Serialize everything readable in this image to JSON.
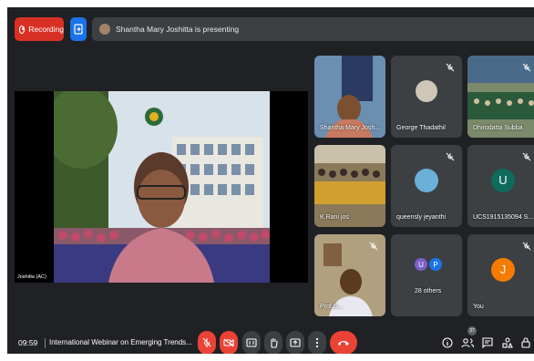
{
  "recording": {
    "label": "Recording"
  },
  "banner": {
    "text": "Shantha Mary Joshitta is presenting"
  },
  "stage": {
    "presenter_label": "Joshitta (AC)"
  },
  "tiles": [
    {
      "label": "Shantha Mary Josh..."
    },
    {
      "label": "George Thadathil"
    },
    {
      "label": "Dhirodatta Subba"
    },
    {
      "label": "K.Rani jos"
    },
    {
      "label": "queensly jeyanthi"
    },
    {
      "label": "UCS1915135094 S...",
      "initial": "U",
      "color": "#0f6b5c"
    },
    {
      "label": "Prof.S..."
    },
    {
      "label": "28 others",
      "initials": [
        "U",
        "P"
      ],
      "colors": [
        "#7b5fc7",
        "#1a73e8"
      ]
    },
    {
      "label": "You",
      "initial": "J",
      "color": "#f57c00"
    }
  ],
  "bottom": {
    "time": "09:59",
    "meeting_title": "International Webinar on Emerging Trends...",
    "participants_count": "37"
  },
  "icons": [
    "record-icon",
    "present-screen-icon",
    "mic-off-icon",
    "camera-off-icon",
    "captions-icon",
    "raise-hand-icon",
    "present-icon",
    "more-options-icon",
    "end-call-icon",
    "info-icon",
    "people-icon",
    "chat-icon",
    "activities-icon",
    "host-controls-icon"
  ],
  "colors": {
    "bg": "#202124",
    "tile": "#3c4043",
    "danger": "#ea4335",
    "accent": "#1a73e8"
  }
}
